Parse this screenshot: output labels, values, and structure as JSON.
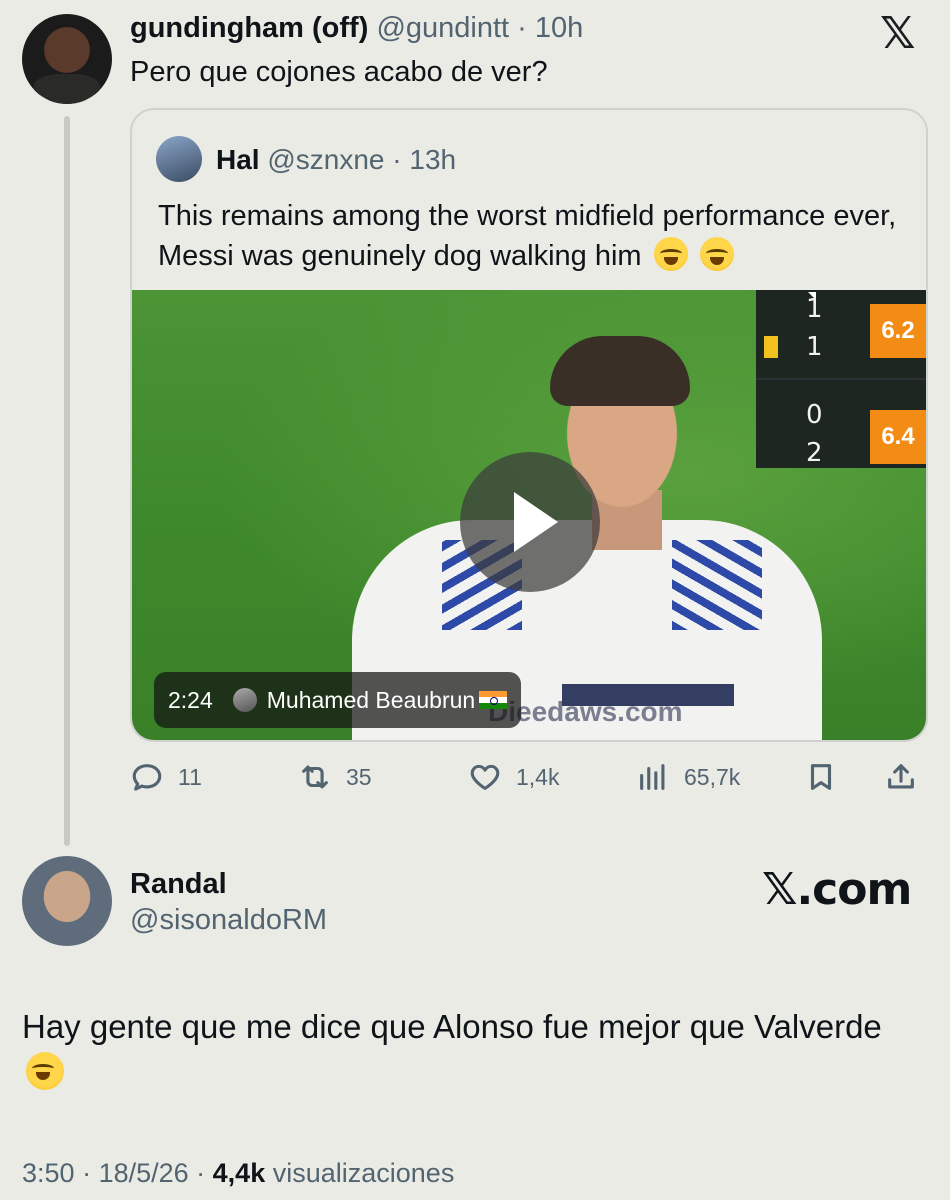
{
  "tweet": {
    "author_name": "gundingham (off)",
    "handle": "@gundintt",
    "time": "10h",
    "text": "Pero que cojones acabo de ver?"
  },
  "quote": {
    "author_name": "Hal",
    "handle": "@sznxne",
    "time": "13h",
    "text": "This remains among the worst midfield performance ever, Messi was genuinely dog walking him",
    "emojis": [
      "loudly-crying-face",
      "loudly-crying-face"
    ],
    "video": {
      "duration": "2:24",
      "uploader": "Muhamed Beaubrun",
      "uploader_flag": "india-flag",
      "watermark": "Dieedaws.com",
      "scoreboard": {
        "row1_top": "1",
        "row1_bottom": "1",
        "row2_top": "0",
        "row2_bottom": "2",
        "rating1": "6.2",
        "rating2": "6.4"
      }
    }
  },
  "actions": {
    "replies": "11",
    "reposts": "35",
    "likes": "1,4k",
    "views": "65,7k"
  },
  "reply": {
    "author_name": "Randal",
    "handle": "@sisonaldoRM",
    "text": "Hay gente que me dice que Alonso fue mejor que Valverde",
    "emoji": "loudly-crying-face",
    "time": "3:50",
    "date": "18/5/26",
    "views_count": "4,4k",
    "views_label": "visualizaciones"
  },
  "brand": {
    "x_logo": "𝕏",
    "xcom": "𝕏.com"
  },
  "colors": {
    "background": "#ebebe6",
    "secondary_text": "#536471",
    "rating_orange": "#f28c14"
  }
}
